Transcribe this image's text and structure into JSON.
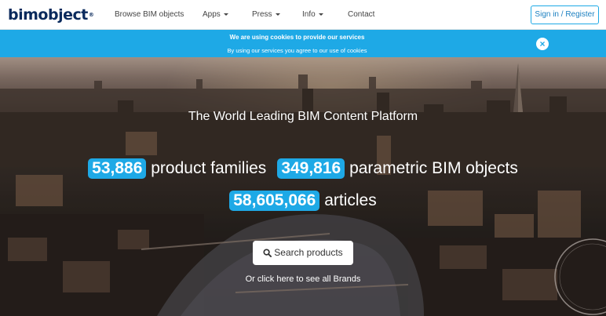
{
  "nav": {
    "logo_text": "bimobject",
    "logo_mark": "®",
    "items": [
      {
        "label": "Browse BIM objects",
        "dropdown": false
      },
      {
        "label": "Apps",
        "dropdown": true
      },
      {
        "label": "Press",
        "dropdown": true
      },
      {
        "label": "Info",
        "dropdown": true
      },
      {
        "label": "Contact",
        "dropdown": false
      }
    ],
    "signin_label": "Sign in / Register"
  },
  "cookie": {
    "line1": "We are using cookies to provide our services",
    "line2": "By using our services you agree to our use of cookies",
    "close_icon": "close-icon"
  },
  "hero": {
    "tagline": "The World Leading BIM Content Platform",
    "stats": [
      {
        "value": "53,886",
        "label": "product families"
      },
      {
        "value": "349,816",
        "label": "parametric BIM objects"
      },
      {
        "value": "58,605,066",
        "label": "articles"
      }
    ],
    "search_label": "Search products",
    "search_icon": "search-icon",
    "brands_link": "Or click here to see all Brands"
  },
  "colors": {
    "accent": "#1ea9e6",
    "logo": "#0a2a5c"
  }
}
